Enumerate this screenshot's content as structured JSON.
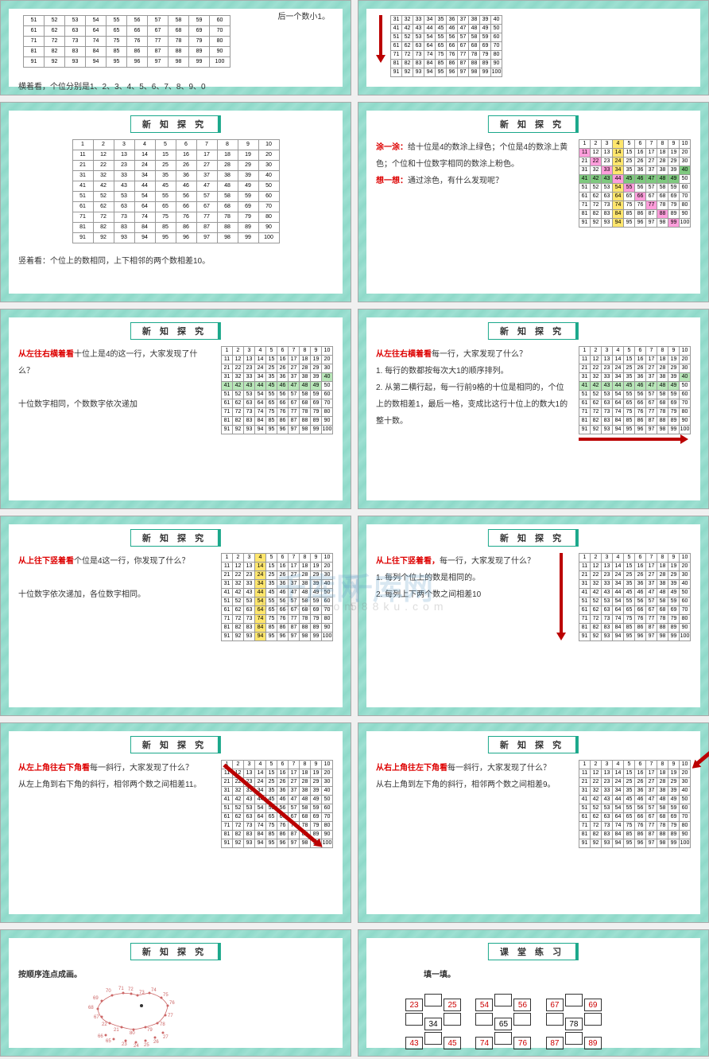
{
  "section_title_explore": "新 知 探 究",
  "section_title_practice": "课 堂 练 习",
  "watermark": "千库网",
  "watermark_sub": "588ku.com",
  "slide1_left": {
    "footer": "横着看，个位分别是1、2、3、4、5、6、7、8、9、0"
  },
  "slide1_right_hint": "后一个数小1。",
  "slide3": {
    "footer": "竖着看：个位上的数相同，上下相邻的两个数相差10。"
  },
  "slide4": {
    "red1": "涂一涂：",
    "text1": "给十位是4的数涂上绿色；个位是4的数涂上黄色；个位和十位数字相同的数涂上粉色。",
    "red2": "想一想：",
    "text2": "通过涂色，有什么发现呢？"
  },
  "slide5": {
    "red": "从左往右横着看",
    "t1": "十位上是4的这一行，大家发现了什么？",
    "t2": "十位数字相同，个数数字依次递加"
  },
  "slide6": {
    "red": "从左往右横着看",
    "t1": "每一行，大家发现了什么？",
    "l1": "1. 每行的数都按每次大1的顺序排列。",
    "l2": "2. 从第二横行起，每一行前9格的十位是相同的，个位上的数相差1，最后一格，变成比这行十位上的数大1的整十数。"
  },
  "slide7": {
    "red": "从上往下竖着看",
    "t1": "个位是4这一行，你发现了什么？",
    "t2": "十位数字依次递加，各位数字相同。"
  },
  "slide8": {
    "red": "从上往下竖着看，",
    "t1": "每一行，大家发现了什么？",
    "l1": "1. 每列个位上的数是相同的。",
    "l2": "2. 每列上下两个数之间相差10"
  },
  "slide9": {
    "red": "从左上角往右下角看",
    "t1": "每一斜行，大家发现了什么？",
    "t2": "从左上角到右下角的斜行，相邻两个数之间相差11。"
  },
  "slide10": {
    "red": "从右上角往左下角看",
    "t1": "每一斜行，大家发现了什么？",
    "t2": "从右上角到左下角的斜行，相邻两个数之间相差9。"
  },
  "slide11": {
    "title": "按顺序连点成画。"
  },
  "slide12": {
    "title": "填一填。",
    "grids": [
      {
        "cells": [
          "23",
          "",
          "25",
          "",
          "34",
          "",
          "43",
          "",
          "45"
        ]
      },
      {
        "cells": [
          "54",
          "",
          "56",
          "",
          "65",
          "",
          "74",
          "",
          "76"
        ]
      },
      {
        "cells": [
          "67",
          "",
          "69",
          "",
          "78",
          "",
          "87",
          "",
          "89"
        ]
      }
    ]
  }
}
